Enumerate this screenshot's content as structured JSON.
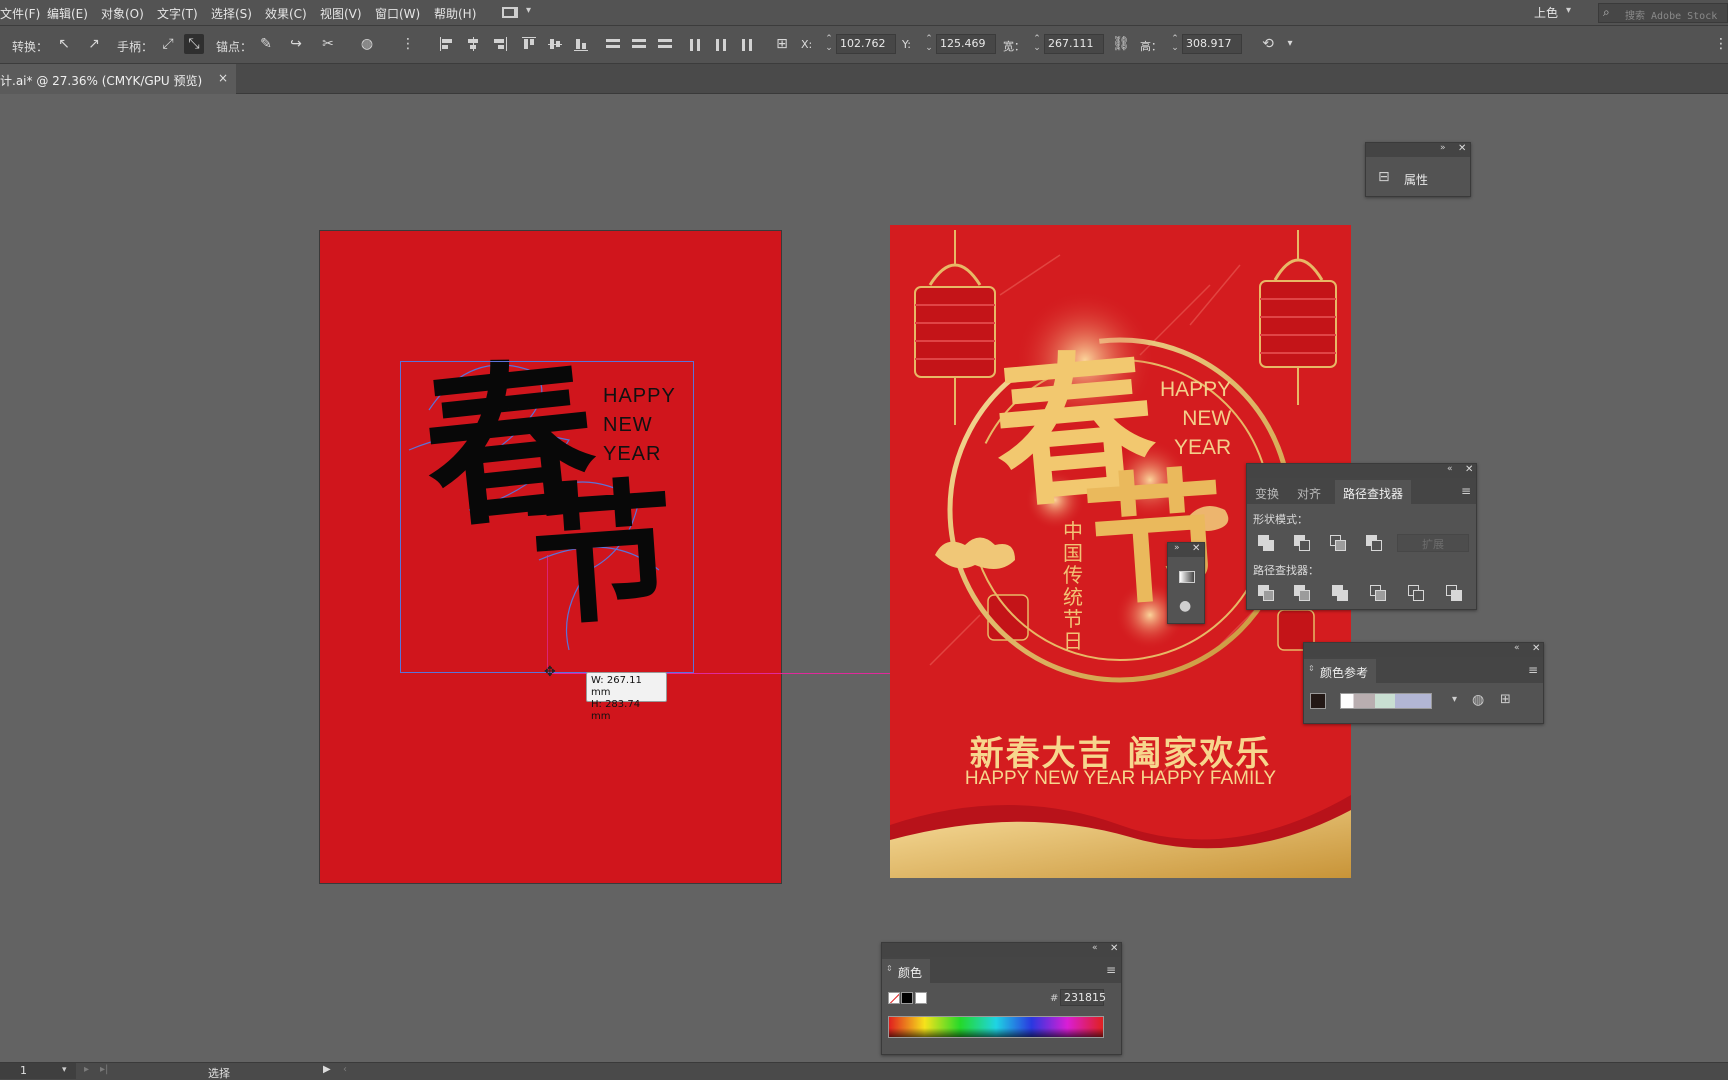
{
  "menu": {
    "items": [
      "文件(F)",
      "编辑(E)",
      "对象(O)",
      "文字(T)",
      "选择(S)",
      "效果(C)",
      "视图(V)",
      "窗口(W)",
      "帮助(H)"
    ],
    "workspace": "上色",
    "search_placeholder": "搜索 Adobe Stock"
  },
  "control_bar": {
    "convert_label": "转换：",
    "handles_label": "手柄：",
    "anchor_label": "锚点：",
    "x_label": "X:",
    "x_value": "102.762",
    "y_label": "Y:",
    "y_value": "125.469",
    "w_label": "宽：",
    "w_value": "267.111",
    "h_label": "高：",
    "h_value": "308.917"
  },
  "document_tab": {
    "title": "计.ai* @ 27.36% (CMYK/GPU 预览)",
    "close": "×"
  },
  "artboard_left": {
    "char1": "春",
    "char2": "节",
    "happy": [
      "HAPPY",
      "NEW",
      "YEAR"
    ],
    "tooltip_w": "W: 267.11 mm",
    "tooltip_h": "H: 283.74 mm"
  },
  "artboard_right": {
    "char1": "春",
    "char2": "节",
    "happy": [
      "HAPPY",
      "NEW",
      "YEAR"
    ],
    "subtitle": "中国传统节日",
    "slogan": "新春大吉 阖家欢乐",
    "slogan_en": "HAPPY NEW YEAR HAPPY FAMILY"
  },
  "properties_panel": {
    "label": "属性"
  },
  "pathfinder_panel": {
    "tabs": [
      "变换",
      "对齐",
      "路径查找器"
    ],
    "active_tab": 2,
    "shape_modes_label": "形状模式：",
    "pathfinders_label": "路径查找器：",
    "expand_label": "扩展"
  },
  "color_guide_panel": {
    "title": "颜色参考"
  },
  "color_panel": {
    "title": "颜色",
    "hex_label": "#",
    "hex_value": "231815"
  },
  "status_bar": {
    "page": "1",
    "tool": "选择"
  },
  "colors": {
    "poster_red": "#d41c1f",
    "gold": "#f4cf8a",
    "guide_magenta": "#e0299b",
    "selection_blue": "#5b73d9"
  }
}
